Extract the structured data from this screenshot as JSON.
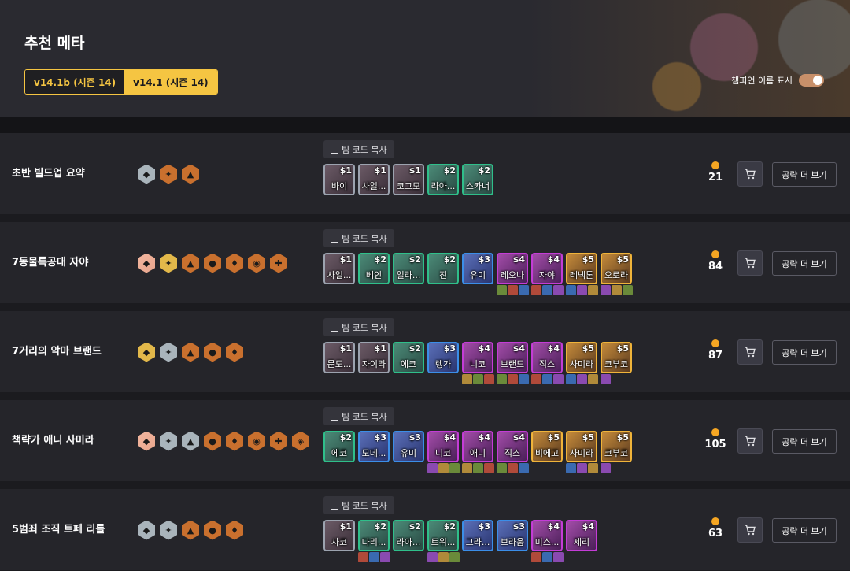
{
  "page": {
    "title": "추천 메타",
    "versions": [
      "v14.1b (시즌 14)",
      "v14.1 (시즌 14)"
    ],
    "toggle_label": "챔피언 이름 표시",
    "copy_label": "팀 코드 복사",
    "more_label": "공략 더 보기"
  },
  "comps": [
    {
      "title": "초반 빌드업 요약",
      "traits": [
        "silver",
        "bronze",
        "bronze"
      ],
      "gold": "21",
      "champs": [
        {
          "cost": "$1",
          "name": "바이",
          "tier": 1,
          "items": 0
        },
        {
          "cost": "$1",
          "name": "사일...",
          "tier": 1,
          "items": 0
        },
        {
          "cost": "$1",
          "name": "코그모",
          "tier": 1,
          "items": 0
        },
        {
          "cost": "$2",
          "name": "라아...",
          "tier": 2,
          "items": 0
        },
        {
          "cost": "$2",
          "name": "스카너",
          "tier": 2,
          "items": 0
        }
      ]
    },
    {
      "title": "7동물특공대 자야",
      "traits": [
        "prism",
        "gold",
        "bronze",
        "bronze",
        "bronze",
        "bronze",
        "bronze"
      ],
      "gold": "84",
      "champs": [
        {
          "cost": "$1",
          "name": "사일...",
          "tier": 1,
          "items": 0
        },
        {
          "cost": "$2",
          "name": "베인",
          "tier": 2,
          "items": 0
        },
        {
          "cost": "$2",
          "name": "일라...",
          "tier": 2,
          "items": 0
        },
        {
          "cost": "$2",
          "name": "진",
          "tier": 2,
          "items": 0
        },
        {
          "cost": "$3",
          "name": "유미",
          "tier": 3,
          "items": 0
        },
        {
          "cost": "$4",
          "name": "레오나",
          "tier": 4,
          "items": 3
        },
        {
          "cost": "$4",
          "name": "자야",
          "tier": 4,
          "items": 3
        },
        {
          "cost": "$5",
          "name": "레넥톤",
          "tier": 5,
          "items": 3
        },
        {
          "cost": "$5",
          "name": "오로라",
          "tier": 5,
          "items": 3
        }
      ]
    },
    {
      "title": "7거리의 악마 브랜드",
      "traits": [
        "gold",
        "silver",
        "bronze",
        "bronze",
        "bronze"
      ],
      "gold": "87",
      "champs": [
        {
          "cost": "$1",
          "name": "문도...",
          "tier": 1,
          "items": 0
        },
        {
          "cost": "$1",
          "name": "자이라",
          "tier": 1,
          "items": 0
        },
        {
          "cost": "$2",
          "name": "에코",
          "tier": 2,
          "items": 0
        },
        {
          "cost": "$3",
          "name": "렝가",
          "tier": 3,
          "items": 0
        },
        {
          "cost": "$4",
          "name": "니코",
          "tier": 4,
          "items": 3
        },
        {
          "cost": "$4",
          "name": "브랜드",
          "tier": 4,
          "items": 3
        },
        {
          "cost": "$4",
          "name": "직스",
          "tier": 4,
          "items": 3
        },
        {
          "cost": "$5",
          "name": "사미라",
          "tier": 5,
          "items": 3
        },
        {
          "cost": "$5",
          "name": "코부코",
          "tier": 5,
          "items": 1
        }
      ]
    },
    {
      "title": "책략가 애니 사미라",
      "traits": [
        "prism",
        "silver",
        "silver",
        "bronze",
        "bronze",
        "bronze",
        "bronze",
        "bronze"
      ],
      "gold": "105",
      "champs": [
        {
          "cost": "$2",
          "name": "에코",
          "tier": 2,
          "items": 0
        },
        {
          "cost": "$3",
          "name": "모데...",
          "tier": 3,
          "items": 0
        },
        {
          "cost": "$3",
          "name": "유미",
          "tier": 3,
          "items": 0
        },
        {
          "cost": "$4",
          "name": "니코",
          "tier": 4,
          "items": 3
        },
        {
          "cost": "$4",
          "name": "애니",
          "tier": 4,
          "items": 3
        },
        {
          "cost": "$4",
          "name": "직스",
          "tier": 4,
          "items": 3
        },
        {
          "cost": "$5",
          "name": "비에고",
          "tier": 5,
          "items": 0
        },
        {
          "cost": "$5",
          "name": "사미라",
          "tier": 5,
          "items": 3
        },
        {
          "cost": "$5",
          "name": "코부코",
          "tier": 5,
          "items": 1
        }
      ]
    },
    {
      "title": "5범죄 조직 트페 리롤",
      "traits": [
        "silver",
        "silver",
        "bronze",
        "bronze",
        "bronze"
      ],
      "gold": "63",
      "champs": [
        {
          "cost": "$1",
          "name": "사코",
          "tier": 1,
          "items": 0
        },
        {
          "cost": "$2",
          "name": "다리...",
          "tier": 2,
          "items": 3
        },
        {
          "cost": "$2",
          "name": "라아...",
          "tier": 2,
          "items": 0
        },
        {
          "cost": "$2",
          "name": "트위...",
          "tier": 2,
          "items": 3
        },
        {
          "cost": "$3",
          "name": "그라...",
          "tier": 3,
          "items": 0
        },
        {
          "cost": "$3",
          "name": "브라움",
          "tier": 3,
          "items": 0
        },
        {
          "cost": "$4",
          "name": "미스...",
          "tier": 4,
          "items": 3
        },
        {
          "cost": "$4",
          "name": "제리",
          "tier": 4,
          "items": 0
        }
      ]
    }
  ],
  "colors": {
    "accent": "#f5c542",
    "gold": "#f5a623",
    "background": "#1b1b1f",
    "row": "#25252a"
  }
}
